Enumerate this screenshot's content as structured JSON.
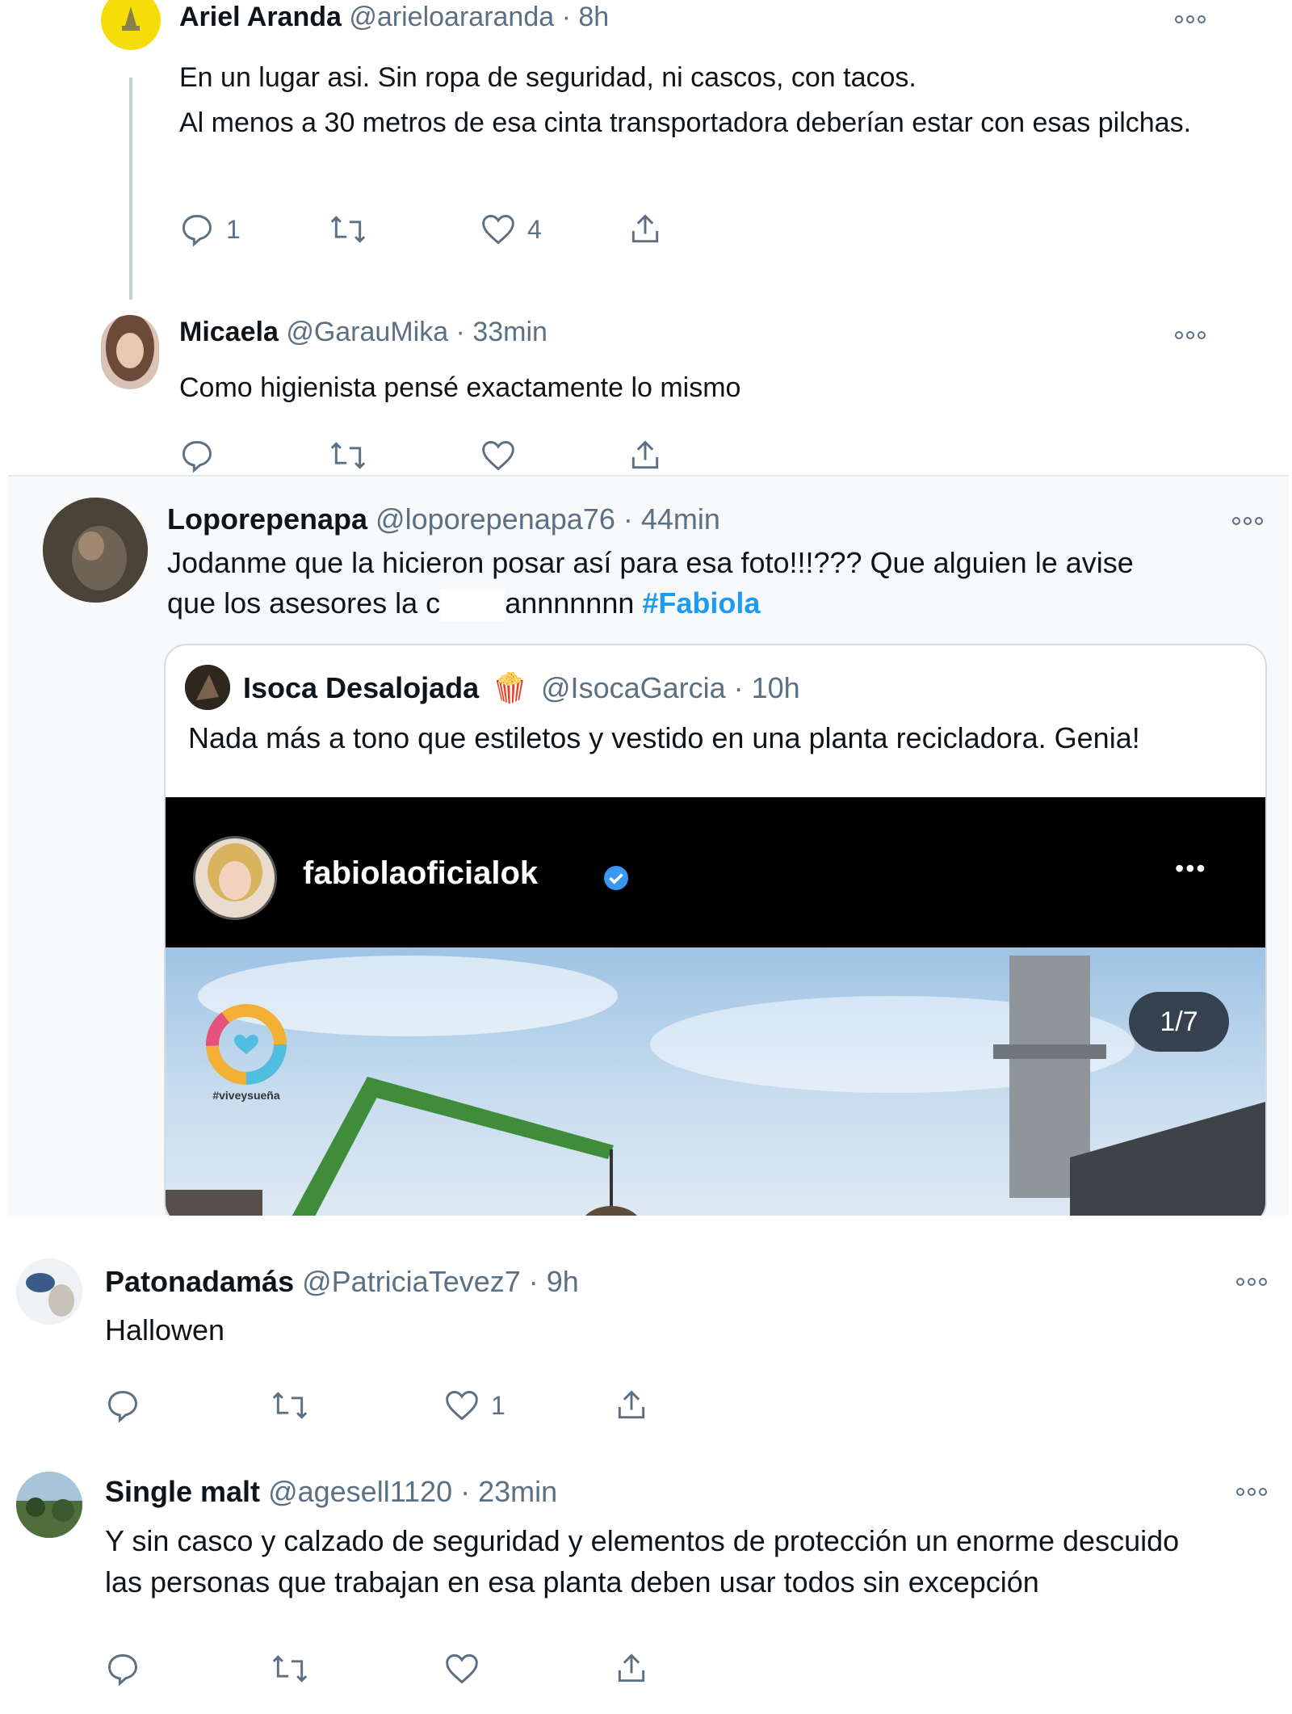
{
  "tweets": [
    {
      "name": "Ariel Aranda",
      "handle": "@arieloararanda · 8h",
      "text": "En un lugar asi. Sin ropa de seguridad, ni cascos, con tacos.\nAl menos a 30 metros de esa cinta transportadora deberían estar con esas pilchas.",
      "replies": "1",
      "retweets": "",
      "likes": "4"
    },
    {
      "name": "Micaela",
      "handle": "@GarauMika · 33min",
      "text": "Como higienista pensé exactamente lo mismo",
      "replies": "",
      "retweets": "",
      "likes": ""
    },
    {
      "name": "Loporepenapa",
      "handle": "@loporepenapa76 · 44min",
      "text_line1": "Jodanme que la hicieron posar así para esa foto!!!??? Que alguien le avise",
      "text_line2_a": "que los asesores la c",
      "text_line2_b": "annnnnnn",
      "hashtag": "#Fabiola"
    },
    {
      "name": "Patonadamás",
      "handle": "@PatriciaTevez7 · 9h",
      "text": "Hallowen",
      "replies": "",
      "retweets": "",
      "likes": "1"
    },
    {
      "name": "Single malt",
      "handle": "@agesell1120 · 23min",
      "text": "Y sin casco y calzado de seguridad y elementos de protección  un enorme descuido las personas que trabajan en esa planta deben usar todos sin excepción",
      "replies": "",
      "retweets": "",
      "likes": ""
    }
  ],
  "quote": {
    "name": "Isoca Desalojada",
    "emoji": "🍿",
    "handle": "@IsocaGarcia · 10h",
    "text": "Nada más a tono que estiletos y vestido en una planta recicladora. Genia!",
    "insta_user": "fabiolaoficialok",
    "insta_more": "•••",
    "photo_counter": "1/7",
    "watermark": "#viveysueña"
  },
  "colors": {
    "accent": "#1d9bf0",
    "secondary_text": "#5b7083",
    "verified": "#3897f0"
  },
  "icons": [
    "reply-icon",
    "retweet-icon",
    "like-icon",
    "share-icon",
    "more-icon",
    "verified-icon"
  ]
}
